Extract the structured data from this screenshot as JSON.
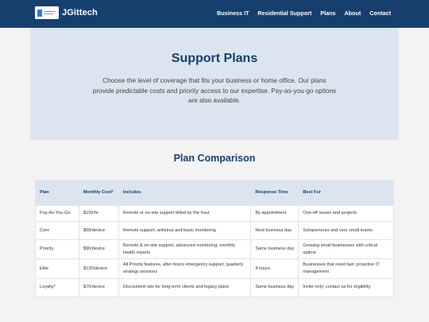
{
  "header": {
    "brand": "JGittech",
    "logo_text": "JGittech",
    "nav": [
      "Business IT",
      "Residential Support",
      "Plans",
      "About",
      "Contact"
    ]
  },
  "hero": {
    "title": "Support Plans",
    "description": "Choose the level of coverage that fits your business or home office. Our plans provide predictable costs and priority access to our expertise. Pay-as-you-go options are also available."
  },
  "comparison": {
    "title": "Plan Comparison",
    "columns": [
      "Plan",
      "Monthly Cost*",
      "Includes",
      "Response Time",
      "Best For"
    ],
    "rows": [
      [
        "Pay-As-You-Go",
        "$150/hr",
        "Remote or on-site support billed by the hour",
        "By appointment",
        "One-off issues and projects"
      ],
      [
        "Core",
        "$60/device",
        "Remote support, antivirus and basic monitoring",
        "Next business day",
        "Solopreneurs and very small teams"
      ],
      [
        "Priority",
        "$90/device",
        "Remote & on-site support, advanced monitoring, monthly health reports",
        "Same business day",
        "Growing small businesses with critical uptime"
      ],
      [
        "Elite",
        "$120/device",
        "All Priority features, after-hours emergency support, quarterly strategy sessions",
        "4 hours",
        "Businesses that need fast, proactive IT management"
      ],
      [
        "Loyalty*",
        "$70/device",
        "Discounted rate for long-term clients and legacy plans",
        "Same business day",
        "Invite-only; contact us for eligibility"
      ]
    ]
  },
  "colors": {
    "header_bg": "#173f6e",
    "hero_bg": "#dce5ef",
    "accent": "#173f6e"
  }
}
